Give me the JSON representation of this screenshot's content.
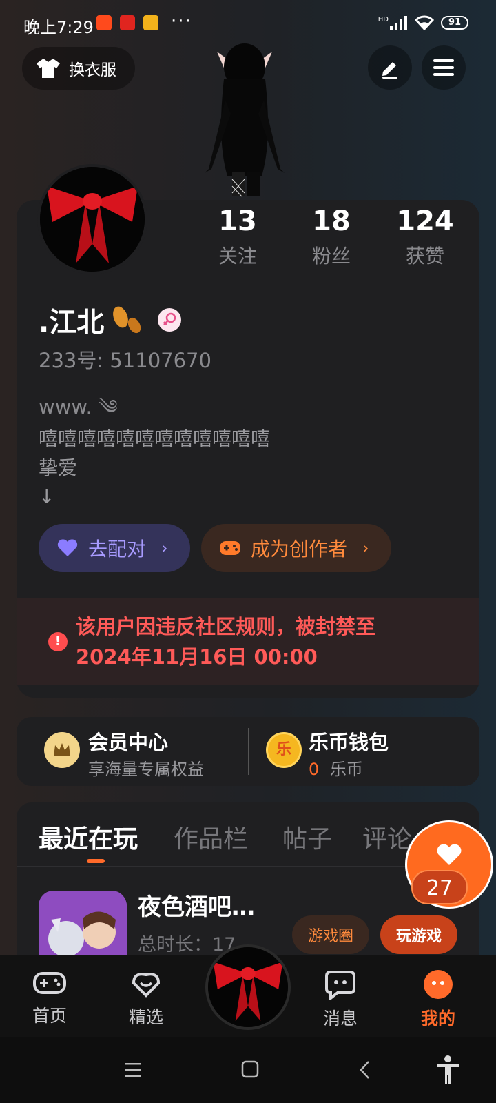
{
  "status_bar": {
    "time": "晚上7:29",
    "dots": "···",
    "network": "HD",
    "battery": "91"
  },
  "header": {
    "outfit_label": "换衣服",
    "edit_icon": "pen-icon",
    "menu_icon": "hamburger-icon"
  },
  "profile": {
    "stats": [
      {
        "value": "13",
        "label": "关注"
      },
      {
        "value": "18",
        "label": "粉丝"
      },
      {
        "value": "124",
        "label": "获赞"
      }
    ],
    "username": ".江北",
    "id_line": "233号: 51107670",
    "web_line": "www.",
    "bio": "嘻嘻嘻嘻嘻嘻嘻嘻嘻嘻嘻嘻\n挚爱\n↓",
    "pair_label": "去配对",
    "creator_label": "成为创作者",
    "ban_text": "该用户因违反社区规则，被封禁至\n2024年11月16日 00:00"
  },
  "member": {
    "vip_title": "会员中心",
    "vip_sub": "享海量专属权益",
    "wallet_title": "乐币钱包",
    "wallet_amount": "0",
    "wallet_unit": "乐币",
    "wallet_icon_char": "乐"
  },
  "tabs": {
    "items": [
      "最近在玩",
      "作品栏",
      "帖子",
      "评论"
    ],
    "active": 0
  },
  "recent_game": {
    "name": "夜色酒吧…",
    "duration": "总时长：17",
    "circle_label": "游戏圈",
    "play_label": "玩游戏"
  },
  "like": {
    "count": "27"
  },
  "bottom_nav": [
    {
      "label": "首页",
      "icon": "gamepad-icon"
    },
    {
      "label": "精选",
      "icon": "heart-bubble-icon"
    },
    {
      "label": "消息",
      "icon": "chat-icon"
    },
    {
      "label": "我的",
      "icon": "profile-face-icon"
    }
  ],
  "colors": {
    "accent": "#ff6a2a",
    "ban_red": "#ff5a58",
    "pair_purple": "#a89bff"
  }
}
